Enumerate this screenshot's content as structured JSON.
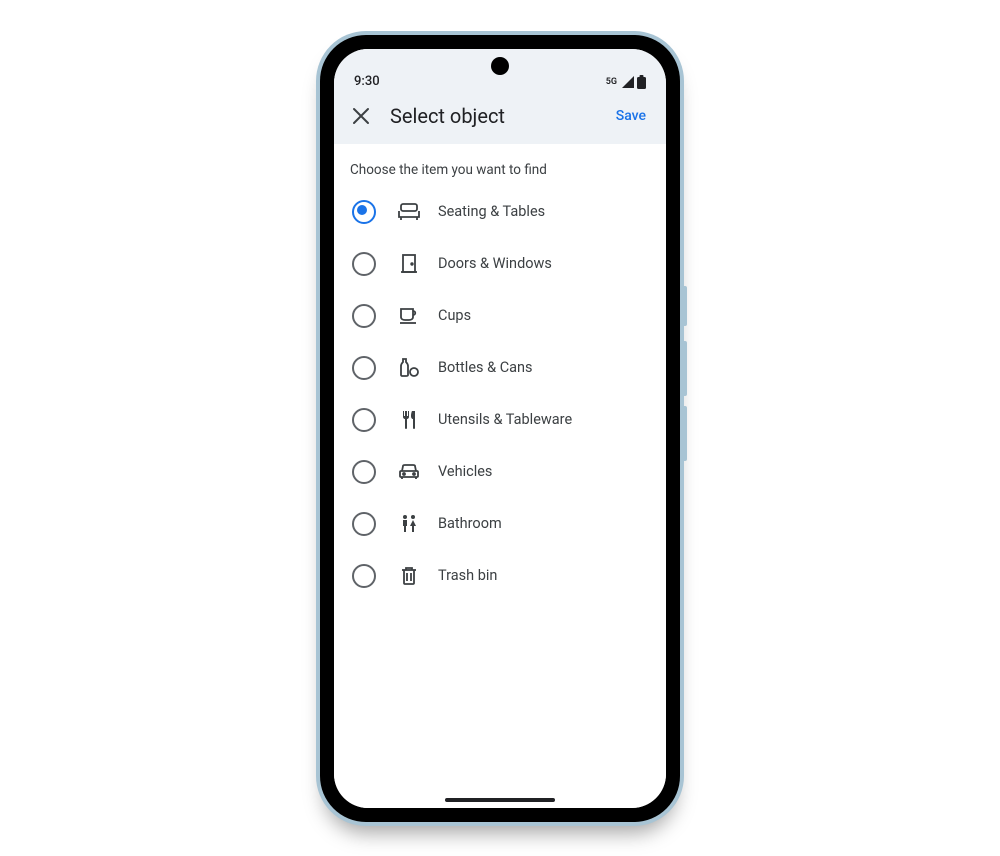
{
  "status": {
    "time": "9:30",
    "network": "5G"
  },
  "appbar": {
    "title": "Select object",
    "save": "Save"
  },
  "subtitle": "Choose the item you want to find",
  "options": [
    {
      "label": "Seating & Tables",
      "selected": true,
      "icon": "seating-icon"
    },
    {
      "label": "Doors & Windows",
      "selected": false,
      "icon": "door-icon"
    },
    {
      "label": "Cups",
      "selected": false,
      "icon": "cup-icon"
    },
    {
      "label": "Bottles & Cans",
      "selected": false,
      "icon": "bottle-icon"
    },
    {
      "label": "Utensils & Tableware",
      "selected": false,
      "icon": "utensils-icon"
    },
    {
      "label": "Vehicles",
      "selected": false,
      "icon": "vehicle-icon"
    },
    {
      "label": "Bathroom",
      "selected": false,
      "icon": "bathroom-icon"
    },
    {
      "label": "Trash bin",
      "selected": false,
      "icon": "trash-icon"
    }
  ]
}
